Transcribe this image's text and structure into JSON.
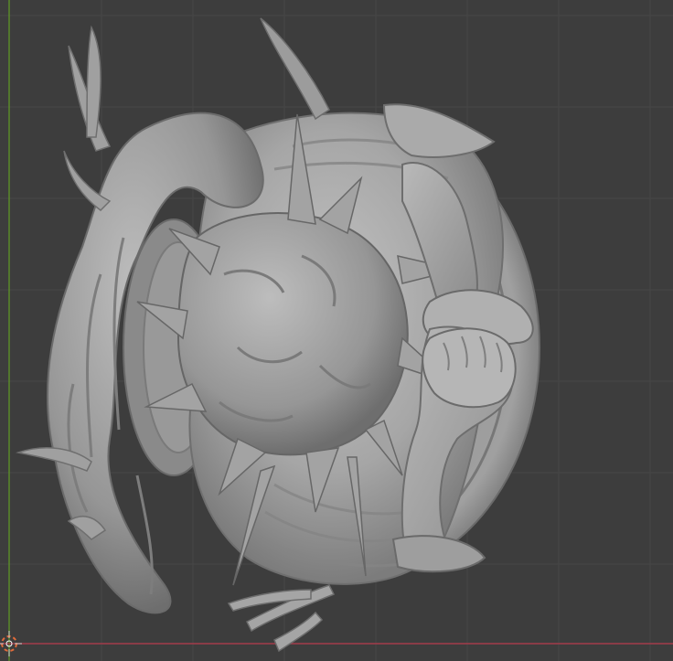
{
  "viewport": {
    "background_color": "#3d3d3d",
    "grid_color": "#4a4a4a",
    "x_axis_color": "#a33c4b",
    "y_axis_color": "#5a8a2a",
    "model_color": "#a8a8a8",
    "cursor_icon": "3d-cursor-icon",
    "object_description": "sculpted-figure-model"
  }
}
